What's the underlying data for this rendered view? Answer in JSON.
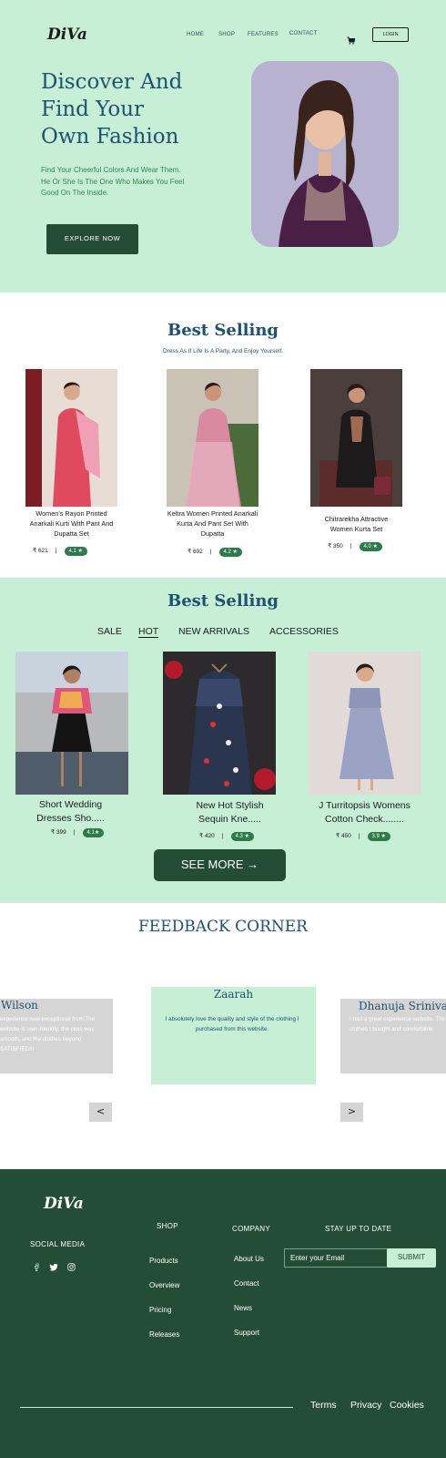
{
  "header": {
    "logo": "DiVa",
    "nav": [
      "HOME",
      "SHOP",
      "FEATURES",
      "CONTACT"
    ],
    "login": "LOGIN"
  },
  "hero": {
    "title_lines": [
      "Discover And",
      "Find Your",
      "Own Fashion"
    ],
    "subtitle_lines": [
      "Find Your Cheerful Colors And Wear Them.",
      "He Or She Is The One Who Makes You Feel",
      "Good On The Inside."
    ],
    "cta": "EXPLORE  NOW"
  },
  "best_selling": {
    "title": "Best Selling",
    "subtitle": "Dress As If Life Is A Party, And Enjoy Yourself.",
    "products": [
      {
        "name_lines": [
          "Women's Rayon Printed",
          "Anarkali Kurti With Pant And",
          "Dupatta Set"
        ],
        "price": "₹ 621",
        "rating": "4.1 ★"
      },
      {
        "name_lines": [
          "Keltra Women Printed Anarkali",
          "Kurta And Pant Set With",
          "Dupatta"
        ],
        "price": "₹ 692",
        "rating": "4.2 ★"
      },
      {
        "name_lines": [
          "Chitrarekha Attractive",
          "Women Kurta Set"
        ],
        "price": "₹ 350",
        "rating": "4.0 ★"
      }
    ]
  },
  "best_selling_2": {
    "title": "Best Selling",
    "tabs": [
      "SALE",
      "HOT",
      "NEW ARRIVALS",
      "ACCESSORIES"
    ],
    "active_tab": "HOT",
    "products": [
      {
        "name_lines": [
          "Short Wedding",
          "Dresses Sho....."
        ],
        "price": "₹ 399",
        "rating": "4.1★"
      },
      {
        "name_lines": [
          "New Hot Stylish",
          "Sequin Kne....."
        ],
        "price": "₹ 420",
        "rating": "4.3 ★"
      },
      {
        "name_lines": [
          "J Turritopsis Womens",
          "Cotton Check........"
        ],
        "price": "₹ 450",
        "rating": "3.9 ★"
      }
    ],
    "see_more": "SEE MORE  →"
  },
  "feedback": {
    "title": "FEEDBACK CORNER",
    "cards": [
      {
        "name": "Wilson",
        "text": "experience was exceptional from The website is user-friendly, the cess was smooth, and the clothes beyond SATISFIED!!!"
      },
      {
        "name": "Zaarah",
        "text": "I absolutely love the quality and style of the clothing I purchased from this website."
      },
      {
        "name": "Dhanuja Srinivas",
        "text": "I had a great experience website. The clothes I bought and comfortable."
      }
    ],
    "prev": "<",
    "next": ">"
  },
  "footer": {
    "logo": "DiVa",
    "social_title": "SOCIAL  MEDIA",
    "social_icons": [
      "facebook-icon",
      "twitter-icon",
      "instagram-icon"
    ],
    "shop_title": "SHOP",
    "shop_links": [
      "Products",
      "Overview",
      "Pricing",
      "Releases"
    ],
    "company_title": "COMPANY",
    "company_links": [
      "About Us",
      "Contact",
      "News",
      "Support"
    ],
    "newsletter_title": "STAY  UP  TO  DATE",
    "email_placeholder": "Enter your Email",
    "submit": "SUBMIT",
    "bottom_links": [
      "Terms",
      "Privacy",
      "Cookies"
    ]
  },
  "colors": {
    "mint": "#c6efd6",
    "dark_green": "#234d34",
    "title_blue": "#1f5170",
    "rating_green": "#2d7a4a"
  }
}
